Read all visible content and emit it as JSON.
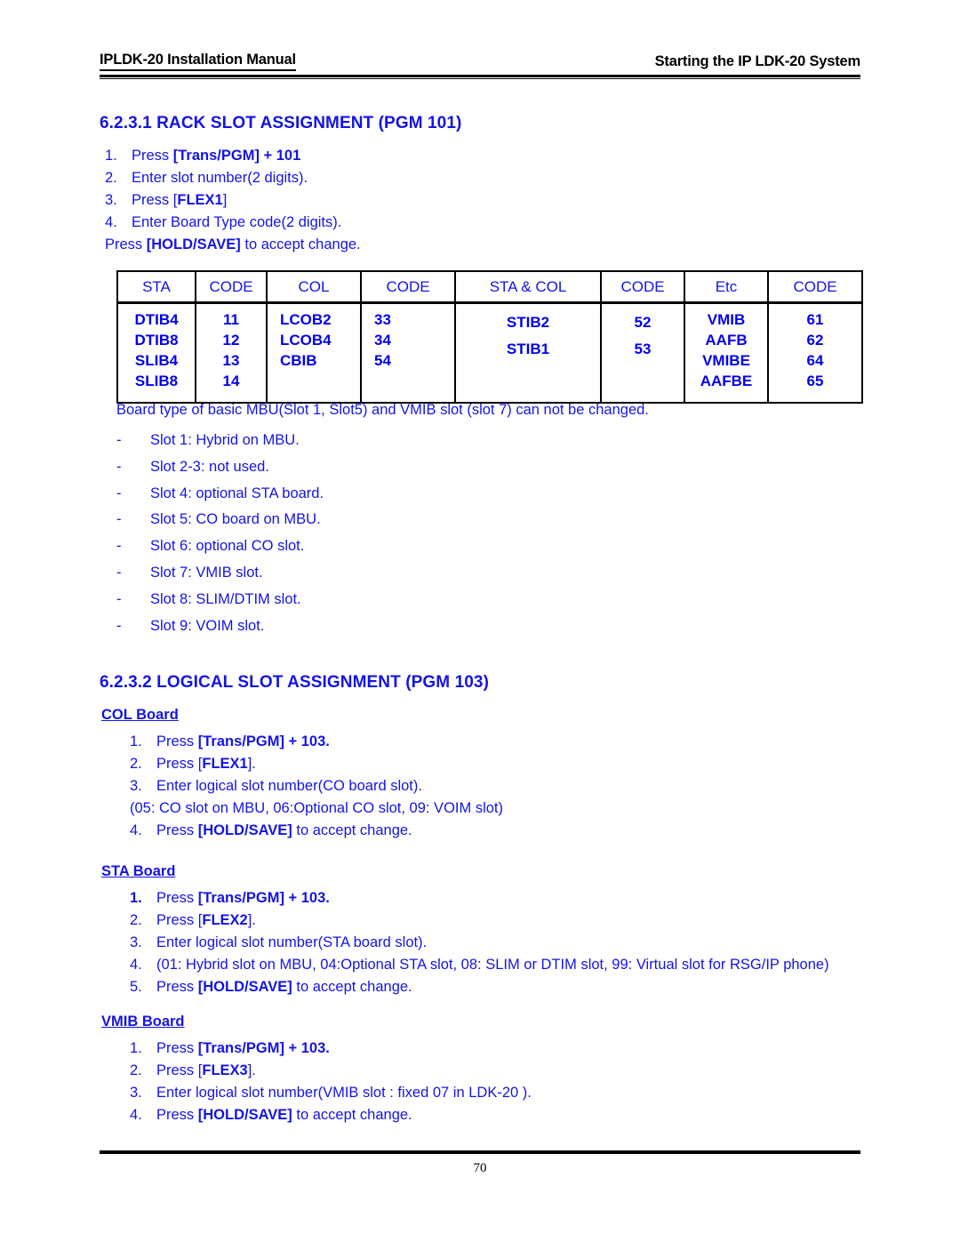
{
  "header": {
    "left": "IPLDK-20 Installation Manual",
    "right": "Starting the IP LDK-20 System"
  },
  "footer": {
    "page_number": "70"
  },
  "sections": [
    {
      "id": "6.2.3.1",
      "heading": "6.2.3.1  RACK SLOT ASSIGNMENT (PGM 101)",
      "steps": [
        {
          "num": "1.",
          "text_html": "Press <b>[Trans/PGM] + 101</b>"
        },
        {
          "num": "2.",
          "text_html": "Enter slot number(2 digits)."
        },
        {
          "num": "3.",
          "text_html": "Press [<b>FLEX1</b>]"
        },
        {
          "num": "4.",
          "text_html": "Enter Board Type code(2 digits)."
        },
        {
          "num": "",
          "text_html": "Press <b>[HOLD/SAVE]</b> to accept change."
        }
      ]
    },
    {
      "id": "6.2.3.2",
      "heading": "6.2.3.2 LOGICAL SLOT ASSIGNMENT  (PGM 103)",
      "groups": [
        {
          "title": "COL Board",
          "steps": [
            {
              "num": "1.",
              "text_html": "Press <b>[Trans/PGM] + 103.</b>"
            },
            {
              "num": "2.",
              "text_html": "Press [<b>FLEX1</b>]."
            },
            {
              "num": "3.",
              "text_html": "Enter logical slot number(CO board slot)."
            },
            {
              "num": "",
              "text_html": "(05: CO slot on MBU, 06:Optional CO slot, 09: VOIM slot)"
            },
            {
              "num": "4.",
              "text_html": "Press <b>[HOLD/SAVE]</b> to accept change."
            }
          ]
        },
        {
          "title": "STA Board",
          "steps": [
            {
              "num": "1.",
              "text_html": "Press <b>[Trans/PGM] + 103.</b>",
              "bold_num": true
            },
            {
              "num": "2.",
              "text_html": "Press [<b>FLEX2</b>]."
            },
            {
              "num": "3.",
              "text_html": "Enter logical slot number(STA board slot)."
            },
            {
              "num": "4.",
              "text_html": "(01: Hybrid slot on MBU, 04:Optional STA slot, 08: SLIM or DTIM slot, 99: Virtual slot for RSG/IP phone)"
            },
            {
              "num": "5.",
              "text_html": "Press <b>[HOLD/SAVE]</b> to accept change."
            }
          ]
        },
        {
          "title": "VMIB Board",
          "steps": [
            {
              "num": "1.",
              "text_html": "Press <b>[Trans/PGM] + 103.</b>"
            },
            {
              "num": "2.",
              "text_html": "Press [<b>FLEX3</b>]."
            },
            {
              "num": "3.",
              "text_html": "Enter logical slot number(VMIB slot : fixed 07 in LDK-20 )."
            },
            {
              "num": "4.",
              "text_html": "Press <b>[HOLD/SAVE]</b> to accept change."
            }
          ]
        }
      ]
    }
  ],
  "board_table": {
    "headers": [
      "STA",
      "CODE",
      "COL",
      "CODE",
      "STA & COL",
      "CODE",
      "Etc",
      "CODE"
    ],
    "columns": [
      {
        "name": "STA",
        "align": "center",
        "values": [
          "DTIB4",
          "DTIB8",
          "SLIB4",
          "SLIB8"
        ]
      },
      {
        "name": "CODE",
        "align": "center",
        "values": [
          "11",
          "12",
          "13",
          "14"
        ]
      },
      {
        "name": "COL",
        "align": "left",
        "values": [
          "LCOB2",
          "LCOB4",
          "CBIB"
        ]
      },
      {
        "name": "CODE",
        "align": "left",
        "values": [
          "33",
          "34",
          "54"
        ]
      },
      {
        "name": "STA & COL",
        "align": "center",
        "values": [
          "STIB2",
          "STIB1"
        ],
        "wide_leading": true
      },
      {
        "name": "CODE",
        "align": "center",
        "values": [
          "52",
          "53"
        ],
        "wide_leading": true
      },
      {
        "name": "Etc",
        "align": "center",
        "values": [
          "VMIB",
          "AAFB",
          "VMIBE",
          "AAFBE"
        ]
      },
      {
        "name": "CODE",
        "align": "center",
        "values": [
          "61",
          "62",
          "64",
          "65"
        ]
      }
    ]
  },
  "slot_notes": {
    "intro": "Board type of basic MBU(Slot 1, Slot5) and VMIB slot (slot 7) can not be changed.",
    "items": [
      {
        "dash": "-",
        "text": "Slot 1: Hybrid on MBU."
      },
      {
        "dash": "-",
        "text": "Slot 2-3: not used."
      },
      {
        "dash": "-",
        "text": "Slot 4: optional STA board."
      },
      {
        "dash": "-",
        "text": "Slot 5: CO board on MBU."
      },
      {
        "dash": "-",
        "text": "Slot 6: optional CO slot."
      },
      {
        "dash": "-",
        "text": "Slot 7: VMIB slot."
      },
      {
        "dash": "-",
        "text": "Slot 8: SLIM/DTIM slot."
      },
      {
        "dash": "-",
        "text": "Slot 9: VOIM slot."
      }
    ]
  },
  "colors": {
    "text_blue": "#1414e6",
    "table_blue": "#0000ee",
    "rule_black": "#000000"
  }
}
